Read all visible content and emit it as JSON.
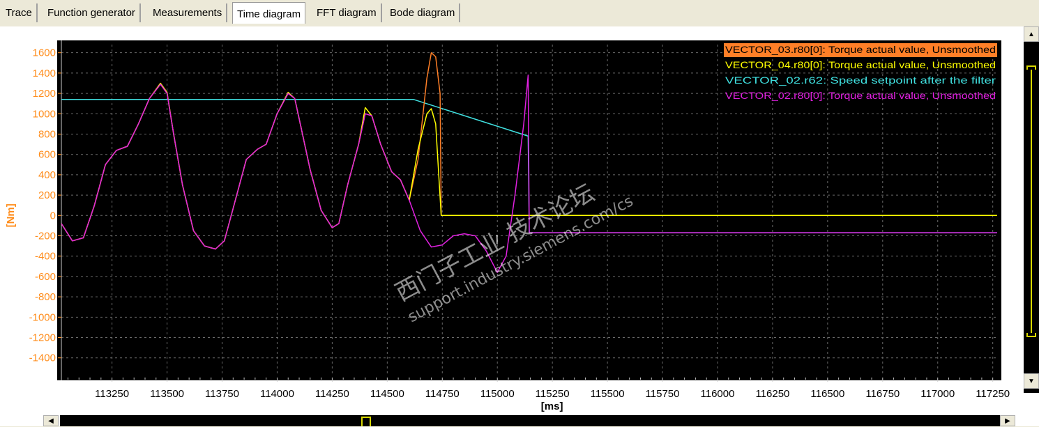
{
  "tabs": [
    {
      "label": "Trace"
    },
    {
      "label": "Function generator"
    },
    {
      "label": "Measurements"
    },
    {
      "label": "Time diagram",
      "active": true
    },
    {
      "label": "FFT diagram"
    },
    {
      "label": "Bode diagram"
    }
  ],
  "watermark": {
    "line1": "西门子工业 技术论坛",
    "line2": "support.industry.siemens.com/cs"
  },
  "scroll": {
    "up_icon": "triangle-up-icon",
    "down_icon": "triangle-down-icon",
    "left_icon": "triangle-left-icon",
    "right_icon": "triangle-right-icon"
  },
  "colors": {
    "background": "#000000",
    "axis_text": "#ff8c1a",
    "axis_text_x": "#000000",
    "grid": "#6a6a6a"
  },
  "chart_data": {
    "type": "line",
    "xlabel": "[ms]",
    "ylabel": "[Nm]",
    "xlim": [
      113020,
      117270
    ],
    "ylim": [
      -1580,
      1680
    ],
    "x_ticks": [
      113250,
      113500,
      113750,
      114000,
      114250,
      114500,
      114750,
      115000,
      115250,
      115500,
      115750,
      116000,
      116250,
      116500,
      116750,
      117000,
      117250
    ],
    "y_ticks": [
      1600,
      1400,
      1200,
      1000,
      800,
      600,
      400,
      200,
      0,
      -200,
      -400,
      -600,
      -800,
      -1000,
      -1200,
      -1400
    ],
    "grid": true,
    "legend_position": "top-right",
    "series": [
      {
        "name": "VECTOR_03.r80[0]: Torque actual value, Unsmoothed",
        "color": "#ff7f27",
        "legend_highlight": true,
        "points": [
          [
            113020,
            -80
          ],
          [
            113070,
            -250
          ],
          [
            113120,
            -220
          ],
          [
            113170,
            100
          ],
          [
            113220,
            500
          ],
          [
            113270,
            640
          ],
          [
            113320,
            680
          ],
          [
            113370,
            900
          ],
          [
            113420,
            1150
          ],
          [
            113470,
            1290
          ],
          [
            113500,
            1200
          ],
          [
            113530,
            800
          ],
          [
            113570,
            300
          ],
          [
            113620,
            -150
          ],
          [
            113670,
            -300
          ],
          [
            113720,
            -330
          ],
          [
            113760,
            -250
          ],
          [
            113810,
            150
          ],
          [
            113860,
            550
          ],
          [
            113910,
            650
          ],
          [
            113950,
            700
          ],
          [
            114000,
            1000
          ],
          [
            114050,
            1200
          ],
          [
            114080,
            1150
          ],
          [
            114110,
            850
          ],
          [
            114150,
            450
          ],
          [
            114200,
            50
          ],
          [
            114250,
            -120
          ],
          [
            114280,
            -80
          ],
          [
            114320,
            300
          ],
          [
            114370,
            700
          ],
          [
            114400,
            1000
          ],
          [
            114430,
            980
          ],
          [
            114470,
            700
          ],
          [
            114520,
            430
          ],
          [
            114560,
            350
          ],
          [
            114600,
            150
          ],
          [
            114640,
            550
          ],
          [
            114680,
            1350
          ],
          [
            114700,
            1600
          ],
          [
            114720,
            1560
          ],
          [
            114740,
            1200
          ],
          [
            114745,
            0
          ],
          [
            117270,
            0
          ]
        ]
      },
      {
        "name": "VECTOR_04.r80[0]: Torque actual value, Unsmoothed",
        "color": "#ffff00",
        "points": [
          [
            113020,
            -80
          ],
          [
            113070,
            -250
          ],
          [
            113120,
            -220
          ],
          [
            113170,
            100
          ],
          [
            113220,
            500
          ],
          [
            113270,
            640
          ],
          [
            113320,
            680
          ],
          [
            113370,
            900
          ],
          [
            113420,
            1150
          ],
          [
            113470,
            1300
          ],
          [
            113500,
            1210
          ],
          [
            113530,
            800
          ],
          [
            113570,
            300
          ],
          [
            113620,
            -150
          ],
          [
            113670,
            -300
          ],
          [
            113720,
            -330
          ],
          [
            113760,
            -250
          ],
          [
            113810,
            150
          ],
          [
            113860,
            550
          ],
          [
            113910,
            650
          ],
          [
            113950,
            700
          ],
          [
            114000,
            1000
          ],
          [
            114050,
            1210
          ],
          [
            114080,
            1150
          ],
          [
            114110,
            850
          ],
          [
            114150,
            450
          ],
          [
            114200,
            50
          ],
          [
            114250,
            -120
          ],
          [
            114280,
            -80
          ],
          [
            114320,
            300
          ],
          [
            114370,
            700
          ],
          [
            114400,
            1060
          ],
          [
            114430,
            980
          ],
          [
            114470,
            700
          ],
          [
            114520,
            430
          ],
          [
            114560,
            350
          ],
          [
            114600,
            150
          ],
          [
            114640,
            650
          ],
          [
            114680,
            1000
          ],
          [
            114700,
            1050
          ],
          [
            114720,
            900
          ],
          [
            114745,
            0
          ],
          [
            117270,
            0
          ]
        ]
      },
      {
        "name": "VECTOR_02.r62: Speed setpoint after the filter",
        "color": "#40e0e0",
        "points": [
          [
            113020,
            1140
          ],
          [
            114620,
            1140
          ],
          [
            115140,
            780
          ],
          [
            115145,
            -170
          ],
          [
            117270,
            -170
          ]
        ]
      },
      {
        "name": "VECTOR_02.r80[0]: Torque actual value, Unsmoothed",
        "color": "#e020e0",
        "points": [
          [
            113020,
            -80
          ],
          [
            113070,
            -250
          ],
          [
            113120,
            -220
          ],
          [
            113170,
            100
          ],
          [
            113220,
            500
          ],
          [
            113270,
            640
          ],
          [
            113320,
            680
          ],
          [
            113370,
            900
          ],
          [
            113420,
            1150
          ],
          [
            113470,
            1290
          ],
          [
            113500,
            1200
          ],
          [
            113530,
            800
          ],
          [
            113570,
            300
          ],
          [
            113620,
            -150
          ],
          [
            113670,
            -300
          ],
          [
            113720,
            -330
          ],
          [
            113760,
            -250
          ],
          [
            113810,
            150
          ],
          [
            113860,
            550
          ],
          [
            113910,
            650
          ],
          [
            113950,
            700
          ],
          [
            114000,
            1000
          ],
          [
            114050,
            1200
          ],
          [
            114080,
            1150
          ],
          [
            114110,
            850
          ],
          [
            114150,
            450
          ],
          [
            114200,
            50
          ],
          [
            114250,
            -120
          ],
          [
            114280,
            -80
          ],
          [
            114320,
            300
          ],
          [
            114370,
            700
          ],
          [
            114400,
            1000
          ],
          [
            114430,
            980
          ],
          [
            114470,
            700
          ],
          [
            114520,
            430
          ],
          [
            114560,
            350
          ],
          [
            114600,
            150
          ],
          [
            114650,
            -150
          ],
          [
            114700,
            -310
          ],
          [
            114750,
            -290
          ],
          [
            114800,
            -200
          ],
          [
            114850,
            -180
          ],
          [
            114900,
            -200
          ],
          [
            114950,
            -350
          ],
          [
            115000,
            -560
          ],
          [
            115040,
            -400
          ],
          [
            115080,
            200
          ],
          [
            115120,
            900
          ],
          [
            115140,
            1380
          ],
          [
            115145,
            -170
          ],
          [
            117270,
            -170
          ]
        ]
      }
    ]
  }
}
